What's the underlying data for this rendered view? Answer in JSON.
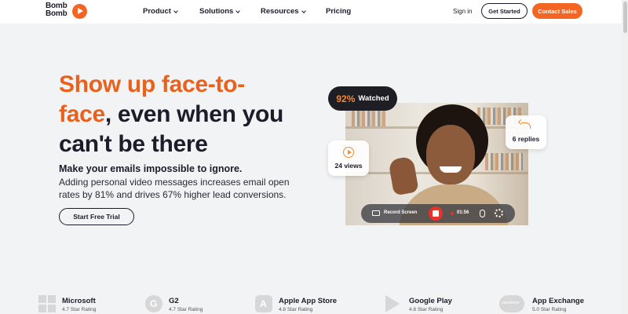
{
  "brand": {
    "logo_line1": "Bomb",
    "logo_line2": "Bomb",
    "accent_color": "#f26522"
  },
  "nav": {
    "items": [
      {
        "label": "Product",
        "dropdown": true
      },
      {
        "label": "Solutions",
        "dropdown": true
      },
      {
        "label": "Resources",
        "dropdown": true
      },
      {
        "label": "Pricing",
        "dropdown": false
      }
    ],
    "sign_in": "Sign in",
    "get_started": "Get Started",
    "contact_sales": "Contact Sales"
  },
  "hero": {
    "headline_part1": "Show up face-to-",
    "headline_part2": "face",
    "headline_part3": ", even when you can't be there",
    "subhead": "Make your emails impossible to ignore.",
    "body": "Adding personal video messages increases email open rates by 81% and drives 67% higher lead conversions.",
    "cta": "Start Free Trial"
  },
  "video": {
    "watched_pct": "92%",
    "watched_label": "Watched",
    "views": "24 views",
    "replies": "6 replies",
    "record_label": "Record Screen",
    "timer": "01:56"
  },
  "ratings": [
    {
      "name": "Microsoft",
      "rating": "4.7 Star Rating",
      "icon": "microsoft-icon"
    },
    {
      "name": "G2",
      "rating": "4.7 Star Rating",
      "icon": "g2-icon"
    },
    {
      "name": "Apple App Store",
      "rating": "4.8 Star Rating",
      "icon": "apple-app-store-icon"
    },
    {
      "name": "Google Play",
      "rating": "4.8 Star Rating",
      "icon": "google-play-icon"
    },
    {
      "name": "App Exchange",
      "rating": "5.0 Star Rating",
      "icon": "salesforce-icon"
    }
  ]
}
